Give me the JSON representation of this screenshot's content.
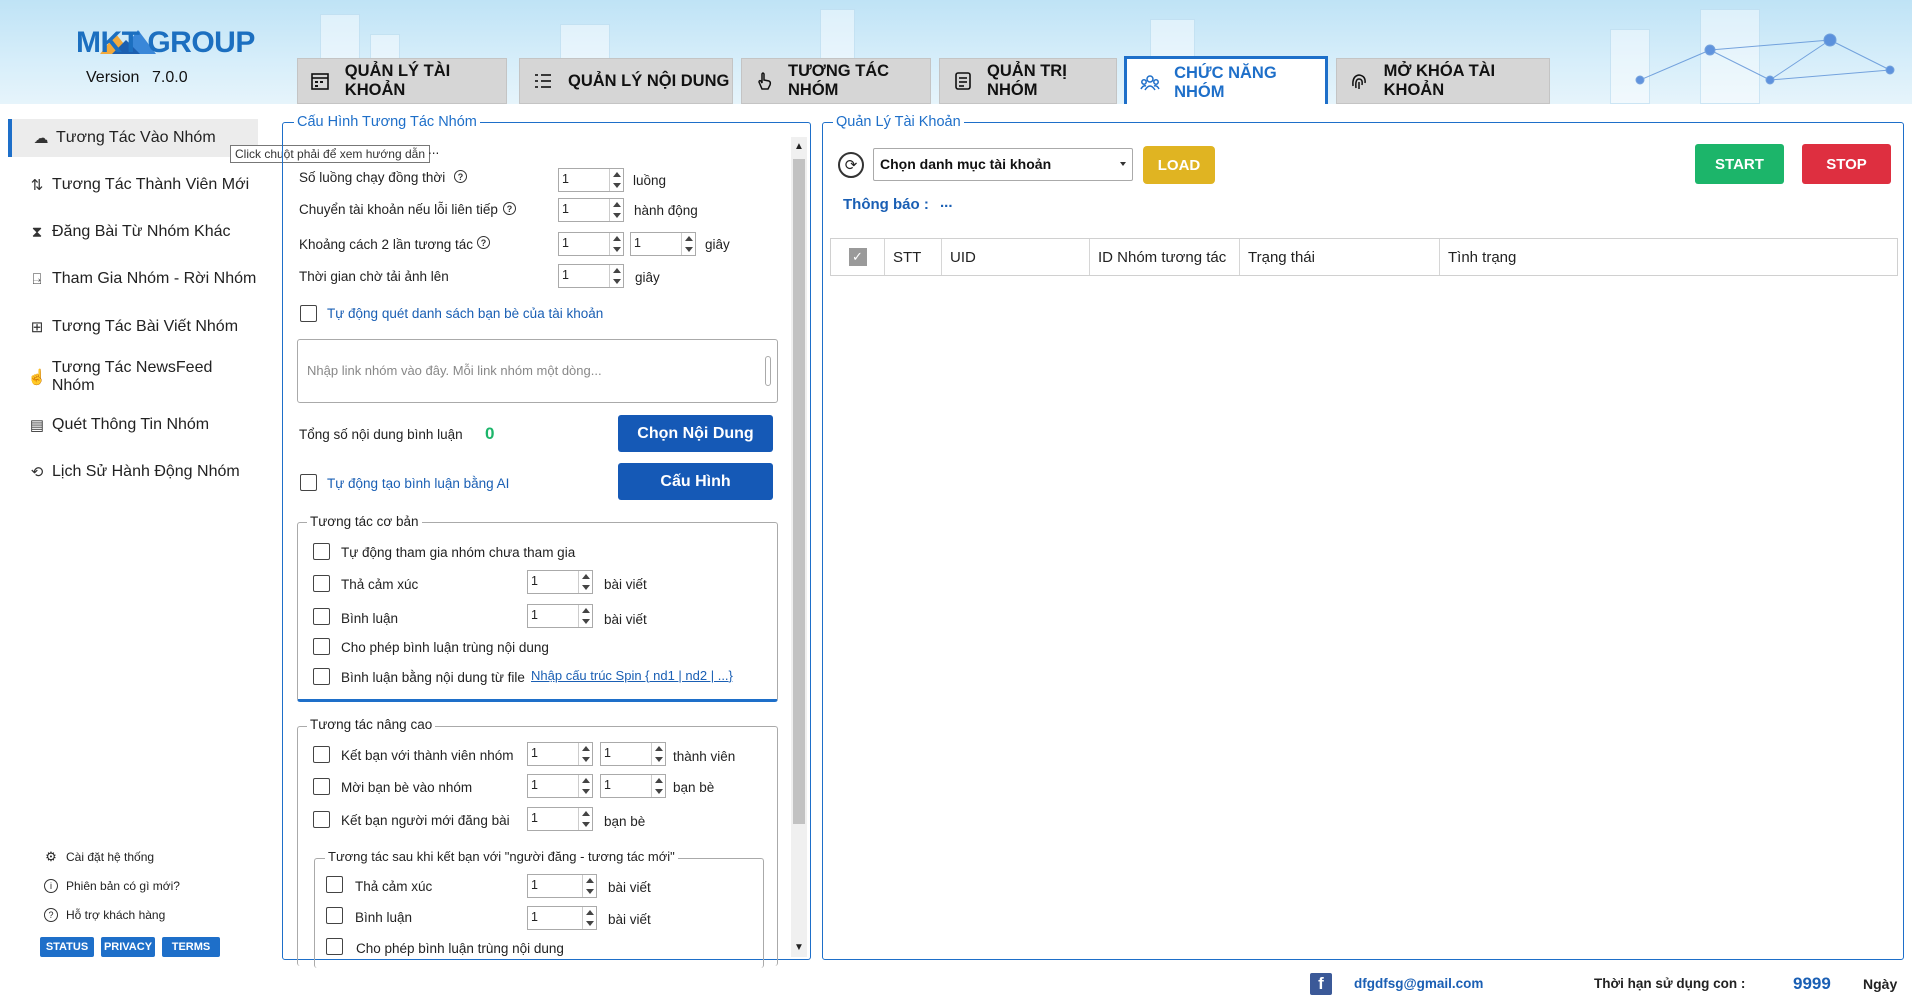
{
  "brand": {
    "logo_text": "MKT GROUP",
    "version_label": "Version",
    "version_value": "7.0.0",
    "accent_color": "#1e6fc9"
  },
  "tabs": [
    {
      "label": "QUẢN LÝ TÀI KHOẢN",
      "icon": "calendar-icon"
    },
    {
      "label": "QUẢN LÝ NỘI DUNG",
      "icon": "list-icon"
    },
    {
      "label": "TƯƠNG TÁC NHÓM",
      "icon": "pointer-hand-icon"
    },
    {
      "label": "QUẢN TRỊ NHÓM",
      "icon": "document-icon"
    },
    {
      "label": "CHỨC NĂNG NHÓM",
      "icon": "group-icon",
      "active": true
    },
    {
      "label": "MỞ KHÓA TÀI KHOẢN",
      "icon": "fingerprint-icon"
    }
  ],
  "sidebar": {
    "items": [
      {
        "label": "Tương Tác Vào Nhóm",
        "icon": "cloud-icon",
        "active": true
      },
      {
        "label": "Tương Tác Thành Viên Mới",
        "icon": "sort-arrows-icon"
      },
      {
        "label": "Đăng Bài Từ Nhóm Khác",
        "icon": "hourglass-icon"
      },
      {
        "label": "Tham Gia Nhóm - Rời Nhóm",
        "icon": "exit-door-icon"
      },
      {
        "label": "Tương Tác Bài Viết Nhóm",
        "icon": "post-icon"
      },
      {
        "label": "Tương Tác NewsFeed Nhóm",
        "icon": "hand-icon"
      },
      {
        "label": "Quét Thông Tin Nhóm",
        "icon": "scan-icon"
      },
      {
        "label": "Lịch Sử Hành Động Nhóm",
        "icon": "history-icon"
      }
    ],
    "tooltip": "Click chuột phải để xem hướng dẫn",
    "footer_links": [
      {
        "label": "Cài đặt hệ thống",
        "icon": "gear-icon"
      },
      {
        "label": "Phiên bản có gì mới?",
        "icon": "info-icon"
      },
      {
        "label": "Hỗ trợ khách hàng",
        "icon": "help-icon"
      }
    ],
    "pills": [
      "STATUS",
      "PRIVACY",
      "TERMS"
    ]
  },
  "config": {
    "title": "Cấu Hình Tương Tác Nhóm",
    "ellipsis": "...",
    "rows": {
      "threads_label": "Số luồng chạy đồng thời",
      "threads_value": "1",
      "threads_unit": "luồng",
      "switch_label": "Chuyển tài khoản nếu lỗi liên tiếp",
      "switch_value": "1",
      "switch_unit": "hành động",
      "gap_label": "Khoảng cách 2 lần tương tác",
      "gap_min": "1",
      "gap_max": "1",
      "gap_unit": "giây",
      "wait_label": "Thời gian chờ tải ảnh lên",
      "wait_value": "1",
      "wait_unit": "giây"
    },
    "auto_scan_label": "Tự động quét danh sách bạn bè của tài khoản",
    "link_placeholder": "Nhập link nhóm vào đây. Mỗi link nhóm một dòng...",
    "total_comments_label": "Tổng số nội dung bình luận",
    "total_comments_value": "0",
    "choose_content_button": "Chọn Nội Dung",
    "ai_comment_label": "Tự động tạo bình luận bằng AI",
    "config_button": "Cấu Hình",
    "basic": {
      "title": "Tương tác cơ bản",
      "auto_join": "Tự động tham gia nhóm chưa tham gia",
      "react_label": "Thả cảm xúc",
      "react_value": "1",
      "react_unit": "bài viết",
      "comment_label": "Bình luận",
      "comment_value": "1",
      "comment_unit": "bài viết",
      "allow_dup": "Cho phép bình luận trùng nội dung",
      "from_file": "Bình luận bằng nội dung từ file",
      "spin_link": "Nhập cấu trúc Spin { nd1 | nd2 | ...}"
    },
    "advanced": {
      "title": "Tương tác nâng cao",
      "add_friend_label": "Kết bạn với thành viên nhóm",
      "add_friend_min": "1",
      "add_friend_max": "1",
      "add_friend_unit": "thành viên",
      "invite_label": "Mời bạn bè vào nhóm",
      "invite_min": "1",
      "invite_max": "1",
      "invite_unit": "bạn bè",
      "poster_label": "Kết bạn người mới đăng bài",
      "poster_value": "1",
      "poster_unit": "bạn bè",
      "after": {
        "title": "Tương tác sau khi kết bạn với \"người đăng - tương tác mới\"",
        "react_label": "Thả cảm xúc",
        "react_value": "1",
        "react_unit": "bài viết",
        "comment_label": "Bình luận",
        "comment_value": "1",
        "comment_unit": "bài viết",
        "allow_dup": "Cho phép bình luận trùng nội dung"
      }
    }
  },
  "accounts": {
    "title": "Quản Lý Tài Khoản",
    "category_select": "Chọn danh mục tài khoản",
    "load_button": "LOAD",
    "start_button": "START",
    "stop_button": "STOP",
    "notice_label": "Thông báo :",
    "notice_value": "...",
    "columns": [
      "STT",
      "UID",
      "ID Nhóm tương tác",
      "Trạng thái",
      "Tình trạng"
    ],
    "colors": {
      "load": "#e0b422",
      "start": "#1cb56a",
      "stop": "#de2f40"
    }
  },
  "footer": {
    "email": "dfgdfsg@gmail.com",
    "expiry_label": "Thời hạn sử dụng con :",
    "expiry_value": "9999",
    "expiry_unit": "Ngày"
  }
}
